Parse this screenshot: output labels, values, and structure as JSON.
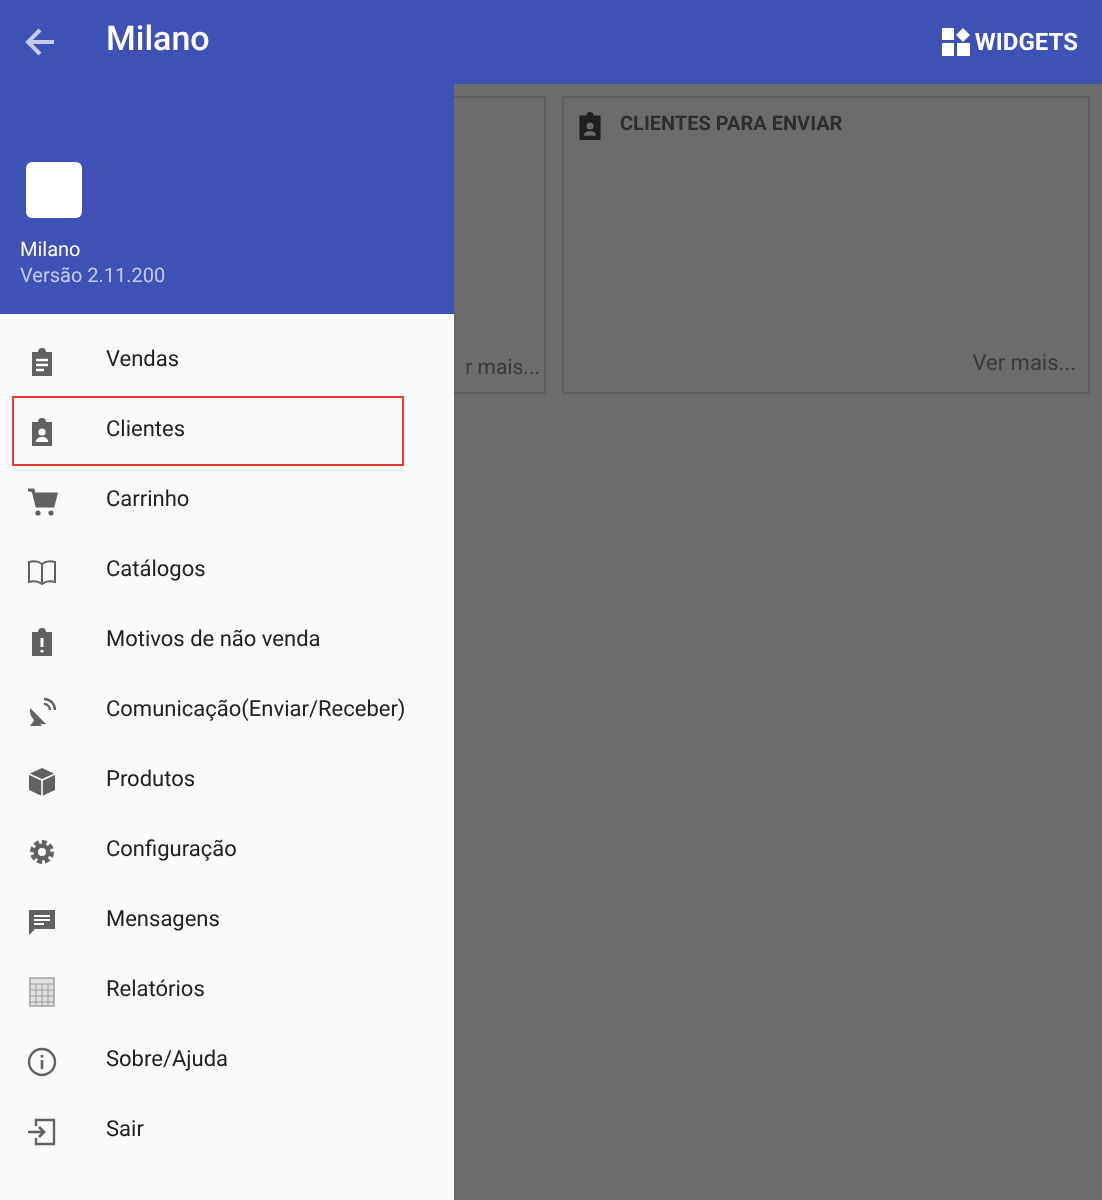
{
  "app_bar": {
    "title": "Milano",
    "action": "WIDGETS"
  },
  "drawer": {
    "header": {
      "name": "Milano",
      "version": "Versão 2.11.200"
    },
    "items": [
      {
        "label": "Vendas",
        "highlighted": false
      },
      {
        "label": "Clientes",
        "highlighted": true
      },
      {
        "label": "Carrinho",
        "highlighted": false
      },
      {
        "label": "Catálogos",
        "highlighted": false
      },
      {
        "label": "Motivos de não venda",
        "highlighted": false
      },
      {
        "label": "Comunicação(Enviar/Receber)",
        "highlighted": false
      },
      {
        "label": "Produtos",
        "highlighted": false
      },
      {
        "label": "Configuração",
        "highlighted": false
      },
      {
        "label": "Mensagens",
        "highlighted": false
      },
      {
        "label": "Relatórios",
        "highlighted": false
      },
      {
        "label": "Sobre/Ajuda",
        "highlighted": false
      },
      {
        "label": "Sair",
        "highlighted": false
      }
    ]
  },
  "widgets": [
    {
      "link": "r mais..."
    },
    {
      "title": "CLIENTES PARA ENVIAR",
      "link": "Ver mais..."
    }
  ]
}
